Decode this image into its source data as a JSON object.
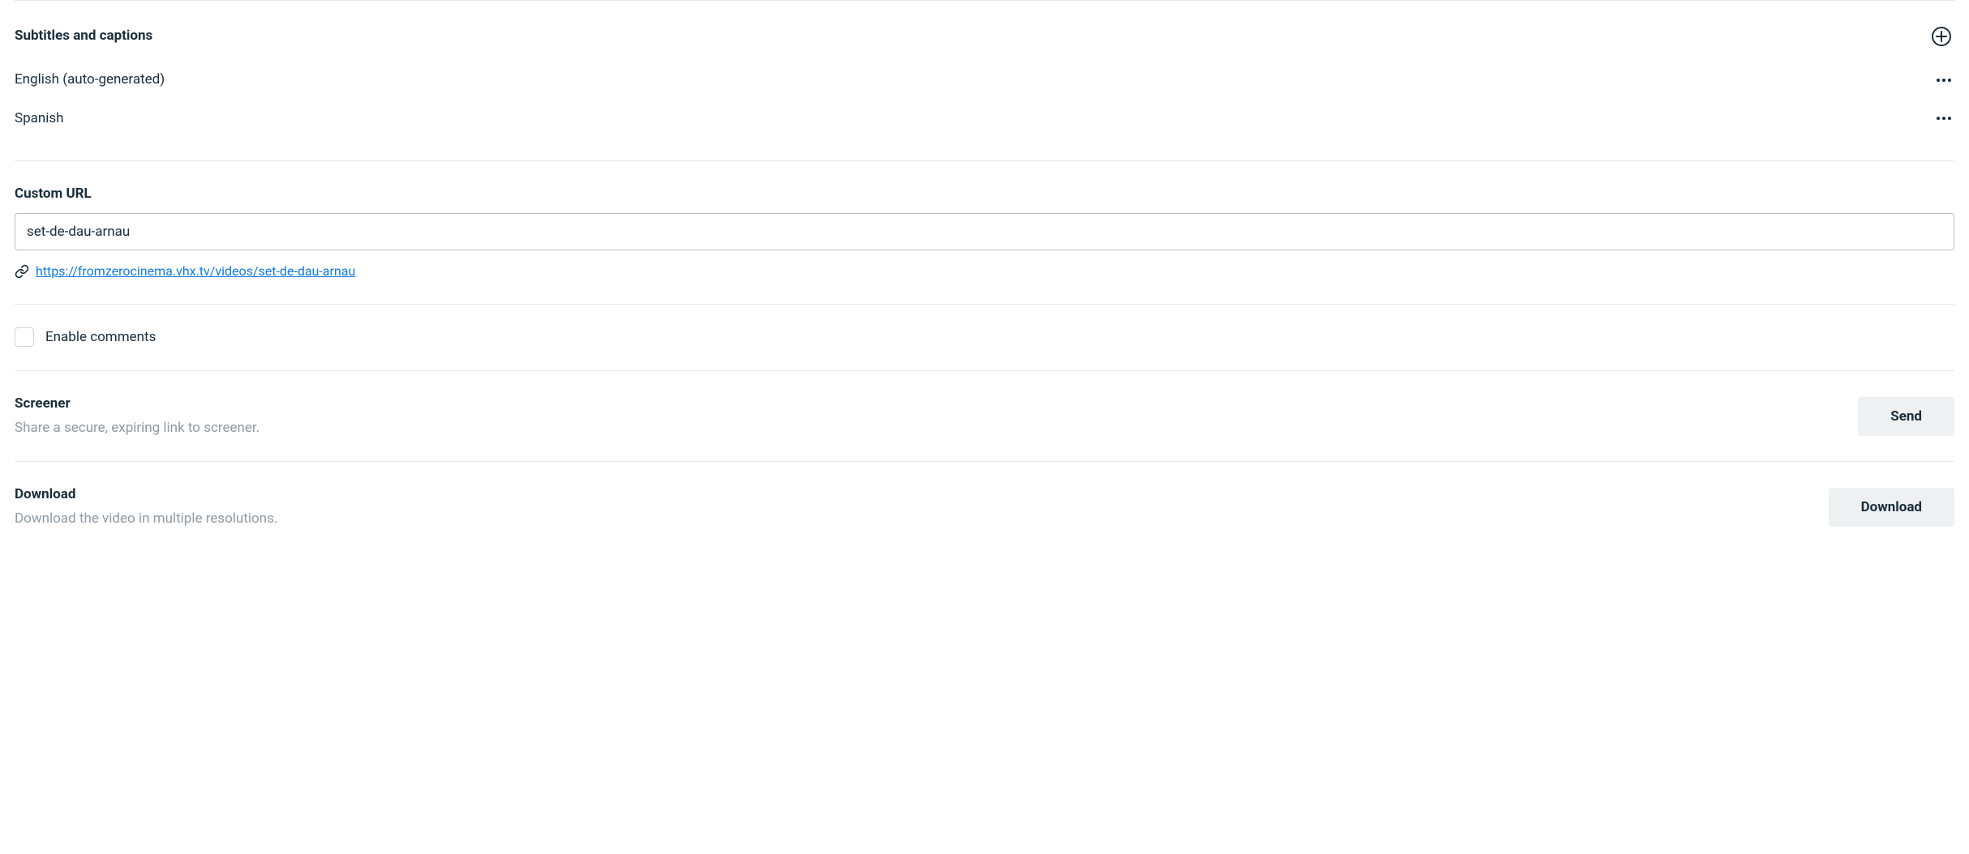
{
  "subtitles": {
    "heading": "Subtitles and captions",
    "items": [
      {
        "label": "English (auto-generated)"
      },
      {
        "label": "Spanish"
      }
    ]
  },
  "customUrl": {
    "label": "Custom URL",
    "value": "set-de-dau-arnau",
    "fullUrl": "https://fromzerocinema.vhx.tv/videos/set-de-dau-arnau"
  },
  "comments": {
    "label": "Enable comments",
    "checked": false
  },
  "screener": {
    "heading": "Screener",
    "description": "Share a secure, expiring link to screener.",
    "buttonLabel": "Send"
  },
  "download": {
    "heading": "Download",
    "description": "Download the video in multiple resolutions.",
    "buttonLabel": "Download"
  }
}
